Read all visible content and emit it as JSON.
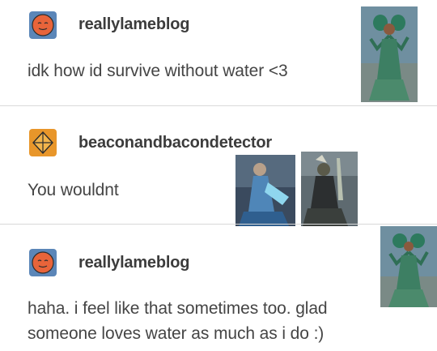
{
  "posts": [
    {
      "username": "reallylameblog",
      "text": "idk how id survive without water <3",
      "avatar_icon": "smiley-avatar-icon",
      "images": [
        "green-haired-character-image"
      ]
    },
    {
      "username": "beaconandbacondetector",
      "text": "You wouldnt",
      "avatar_icon": "diamond-avatar-icon",
      "images": [
        "blue-robed-character-image",
        "dark-armored-character-image"
      ]
    },
    {
      "username": "reallylameblog",
      "text_lines": [
        "haha. i feel like that sometimes too. glad",
        "someone loves water as much as i do :)"
      ],
      "avatar_icon": "smiley-avatar-icon",
      "images": [
        "green-haired-character-image"
      ]
    }
  ],
  "colors": {
    "divider": "#d9d9d9",
    "username": "#3c3c3c",
    "text": "#454545",
    "avatar_bg_blue": "#5b86b8",
    "avatar_face_orange": "#e8643a",
    "avatar_diamond_bg": "#e8962a"
  }
}
